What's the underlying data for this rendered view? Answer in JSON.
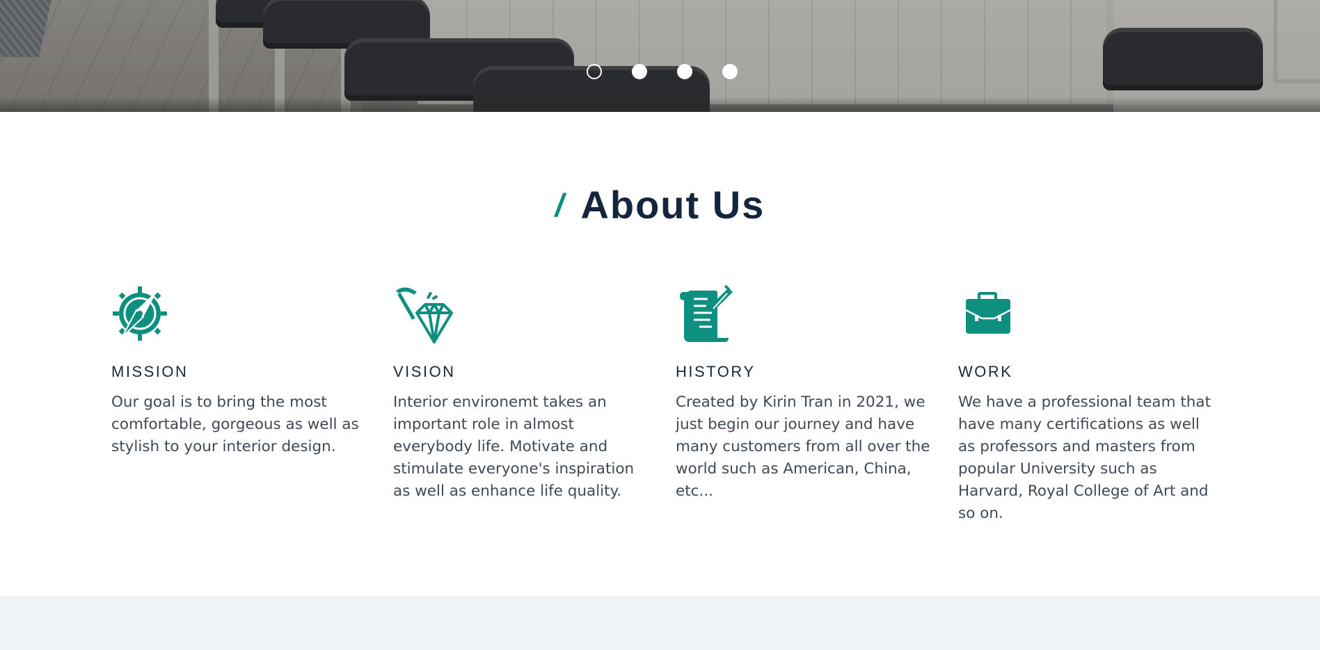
{
  "carousel": {
    "dots": [
      {
        "label": "slide 1",
        "active": true
      },
      {
        "label": "slide 2",
        "active": false
      },
      {
        "label": "slide 3",
        "active": false
      },
      {
        "label": "slide 4",
        "active": false
      }
    ]
  },
  "about": {
    "slash": "/",
    "title": "About Us",
    "accent_color": "#0f8f7f",
    "cards": [
      {
        "icon": "compass-icon",
        "heading": "MISSION",
        "text": "Our goal is to bring the most comfortable, gorgeous as well as stylish to your interior design."
      },
      {
        "icon": "diamond-pickaxe-icon",
        "heading": "VISION",
        "text": "Interior environemt takes an important role in almost everybody life. Motivate and stimulate everyone's inspiration as well as enhance life quality."
      },
      {
        "icon": "scroll-quill-icon",
        "heading": "HISTORY",
        "text": "Created by Kirin Tran in 2021, we just begin our journey and have many customers from all over the world such as American, China, etc..."
      },
      {
        "icon": "briefcase-icon",
        "heading": "WORK",
        "text": "We have a professional team that have many certifications as well as professors and masters from popular University such as Harvard, Royal College of Art and so on."
      }
    ]
  }
}
